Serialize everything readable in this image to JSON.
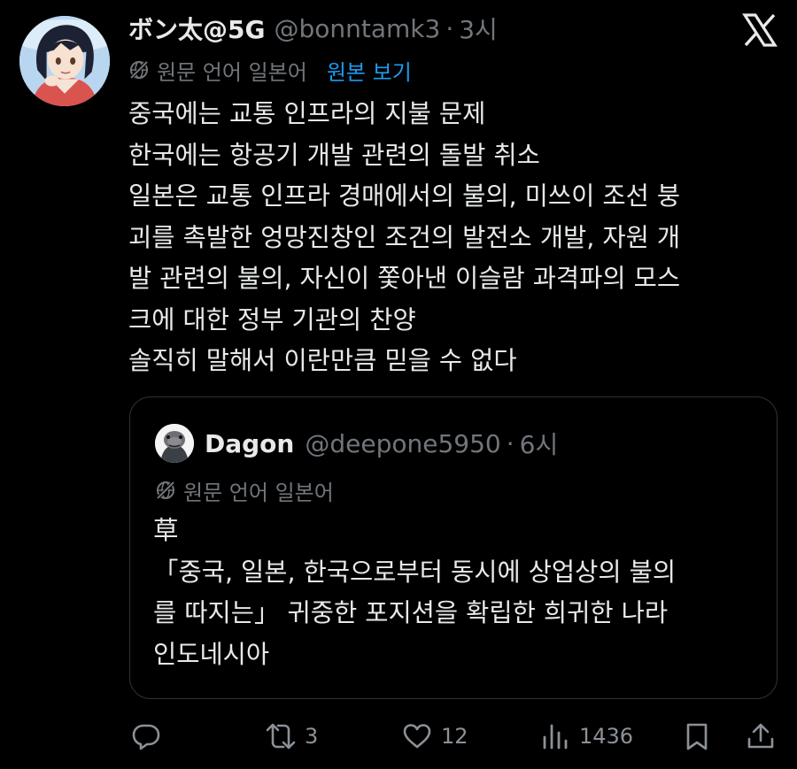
{
  "tweet": {
    "author": {
      "display_name": "ボン太@5G",
      "handle": "@bonntamk3",
      "avatar": "anime-avatar"
    },
    "separator": "·",
    "time": "3시",
    "translation": {
      "label": "원문 언어 일본어",
      "show_original": "원본 보기",
      "icon": "globe-slash-icon"
    },
    "text_lines": [
      "중국에는 교통 인프라의 지불 문제",
      "한국에는 항공기 개발 관련의 돌발 취소",
      "일본은 교통 인프라 경매에서의 불의, 미쓰이 조선 붕",
      "괴를 촉발한 엉망진창인 조건의 발전소 개발, 자원 개",
      "발 관련의 불의, 자신이 쫓아낸 이슬람 과격파의 모스",
      "크에 대한 정부 기관의 찬양",
      "솔직히 말해서 이란만큼 믿을 수 없다"
    ],
    "platform_logo": "x-logo-icon"
  },
  "quote": {
    "author": {
      "display_name": "Dagon",
      "handle": "@deepone5950",
      "avatar": "fish-avatar"
    },
    "separator": "·",
    "time": "6시",
    "translation": {
      "label": "원문 언어 일본어"
    },
    "text_lines": [
      "草",
      "「중국, 일본, 한국으로부터 동시에 상업상의 불의",
      "를 따지는」 귀중한 포지션을 확립한 희귀한 나라",
      "인도네시아"
    ]
  },
  "actions": {
    "reply": {
      "icon": "reply-icon",
      "count": ""
    },
    "retweet": {
      "icon": "retweet-icon",
      "count": "3"
    },
    "like": {
      "icon": "heart-icon",
      "count": "12"
    },
    "views": {
      "icon": "views-icon",
      "count": "1436"
    },
    "bookmark": {
      "icon": "bookmark-icon"
    },
    "share": {
      "icon": "share-icon"
    }
  },
  "colors": {
    "background": "#000000",
    "text_primary": "#e7e9ea",
    "text_secondary": "#71767b",
    "accent_link": "#1d9bf0",
    "border": "#2f3336"
  }
}
